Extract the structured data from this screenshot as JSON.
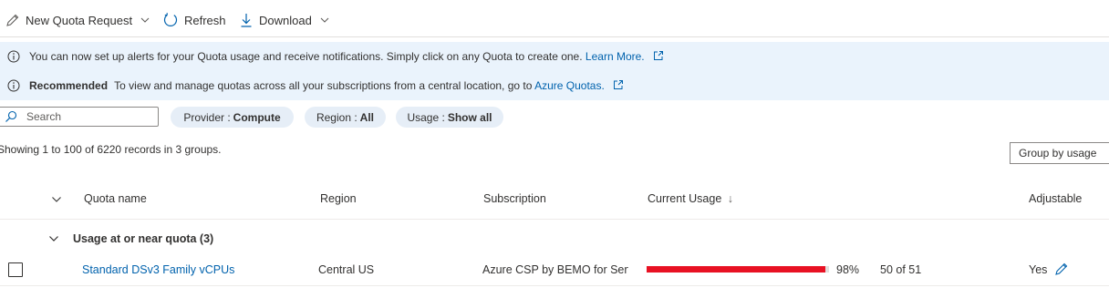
{
  "toolbar": {
    "new_quota_label": "New Quota Request",
    "refresh_label": "Refresh",
    "download_label": "Download"
  },
  "banners": {
    "alerts_text": "You can now set up alerts for your Quota usage and notifications. Simply click on any Quota to create one.",
    "alerts_text_full": "You can now set up alerts for your Quota usage and receive notifications. Simply click on any Quota to create one.",
    "alerts_link": "Learn More.",
    "recommended_title": "Recommended",
    "recommended_text": "To view and manage quotas across all your subscriptions from a central location, go to",
    "recommended_link": "Azure Quotas."
  },
  "filters": {
    "search_placeholder": "Search",
    "provider_key": "Provider :",
    "provider_value": "Compute",
    "region_key": "Region :",
    "region_value": "All",
    "usage_key": "Usage :",
    "usage_value": "Show all"
  },
  "records_text": "Showing 1 to 100 of 6220 records in 3 groups.",
  "group_by_label": "Group by usage",
  "columns": {
    "quota_name": "Quota name",
    "region": "Region",
    "subscription": "Subscription",
    "current_usage": "Current Usage",
    "sort_arrow": "↓",
    "adjustable": "Adjustable"
  },
  "group": {
    "label": "Usage at or near quota (3)"
  },
  "rows": [
    {
      "quota_name": "Standard DSv3 Family vCPUs",
      "region": "Central US",
      "subscription": "Azure CSP by BEMO for Services",
      "usage_percent": 98,
      "usage_percent_label": "98%",
      "usage_count": "50 of 51",
      "adjustable": "Yes"
    }
  ],
  "colors": {
    "accent": "#0062ad",
    "banner_bg": "#eaf3fc",
    "usage_critical": "#e81123"
  },
  "icons": [
    "pencil-icon",
    "chevron-down-icon",
    "refresh-icon",
    "download-icon",
    "info-icon",
    "external-link-icon",
    "search-icon"
  ]
}
